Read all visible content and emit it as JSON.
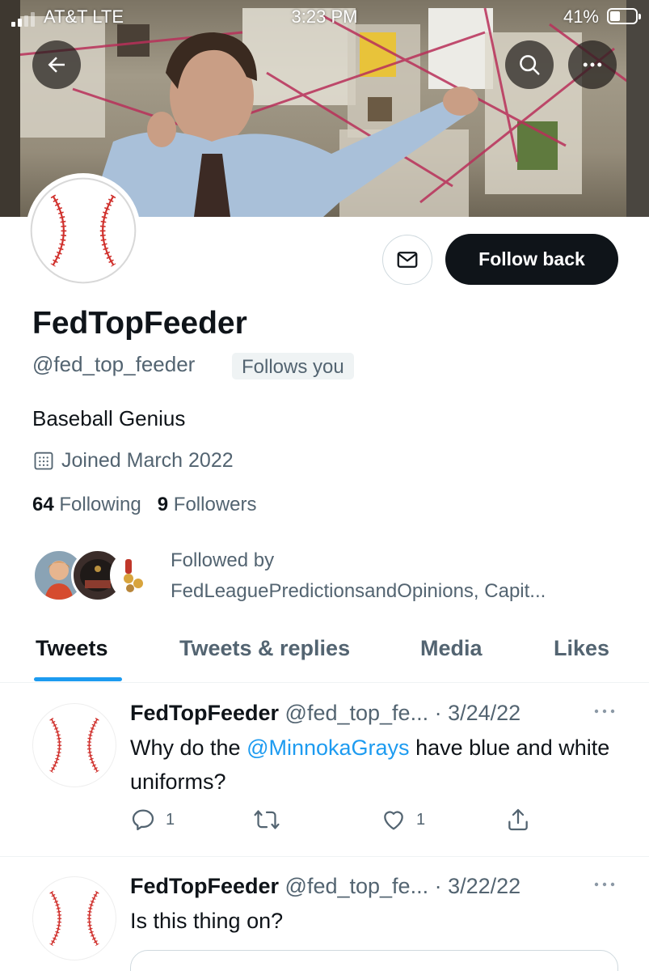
{
  "status_bar": {
    "carrier": "AT&T  LTE",
    "time": "3:23 PM",
    "battery": "41%",
    "battery_level": 0.41
  },
  "header": {
    "back_icon": "arrow-left-icon",
    "search_icon": "search-icon",
    "more_icon": "more-horizontal-icon"
  },
  "profile": {
    "display_name": "FedTopFeeder",
    "handle": "@fed_top_feeder",
    "follows_you": "Follows you",
    "bio": "Baseball Genius",
    "joined": "Joined March 2022",
    "following_count": "64",
    "following_label": "Following",
    "followers_count": "9",
    "followers_label": "Followers",
    "followed_by_label": "Followed by",
    "followed_by_names": "FedLeaguePredictionsandOpinions, Capit...",
    "message_icon": "envelope-icon",
    "follow_button": "Follow back"
  },
  "tabs": [
    {
      "label": "Tweets",
      "active": true
    },
    {
      "label": "Tweets & replies",
      "active": false
    },
    {
      "label": "Media",
      "active": false
    },
    {
      "label": "Likes",
      "active": false
    }
  ],
  "tweets": [
    {
      "name": "FedTopFeeder",
      "meta": "@fed_top_fe... · 3/24/22",
      "text_before": "Why do the ",
      "mention": "@MinnokaGrays",
      "text_after": " have blue and white uniforms?",
      "replies": "1",
      "retweets": "",
      "likes": "1"
    },
    {
      "name": "FedTopFeeder",
      "meta": "@fed_top_fe... · 3/22/22",
      "text": "Is this thing on?"
    }
  ],
  "colors": {
    "accent": "#1d9bf0",
    "text": "#0f1419",
    "secondary": "#536471",
    "baseball_stitch": "#d0312d"
  }
}
